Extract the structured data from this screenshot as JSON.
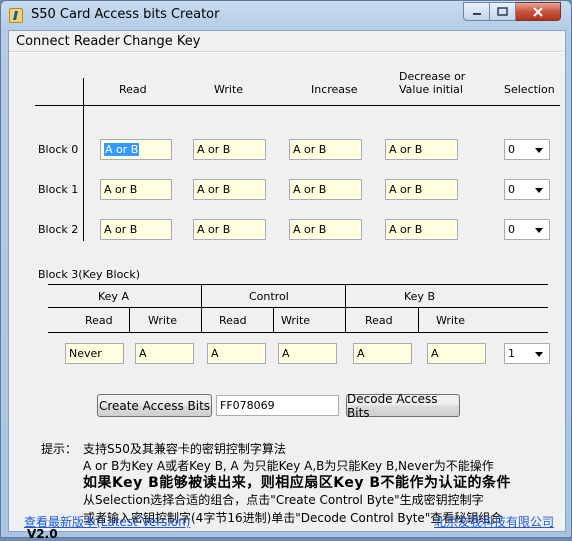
{
  "window": {
    "title": "S50 Card Access bits Creator"
  },
  "menu": {
    "connect_reader": "Connect Reader",
    "change_key": "Change Key"
  },
  "table1": {
    "headers": {
      "read": "Read",
      "write": "Write",
      "increase": "Increase",
      "decrease_line1": "Decrease or",
      "decrease_line2": "Value initial",
      "selection": "Selection"
    },
    "rows": [
      {
        "label": "Block 0",
        "read": "A or B",
        "write": "A or B",
        "increase": "A or B",
        "decrease": "A or B",
        "selection": "0"
      },
      {
        "label": "Block 1",
        "read": "A or B",
        "write": "A or B",
        "increase": "A or B",
        "decrease": "A or B",
        "selection": "0"
      },
      {
        "label": "Block 2",
        "read": "A or B",
        "write": "A or B",
        "increase": "A or B",
        "decrease": "A or B",
        "selection": "0"
      }
    ]
  },
  "block3": {
    "title": "Block 3(Key Block)",
    "group_key_a": "Key A",
    "group_control": "Control",
    "group_key_b": "Key B",
    "sub_read": "Read",
    "sub_write": "Write",
    "values": {
      "key_a_read": "Never",
      "key_a_write": "A",
      "control_read": "A",
      "control_write": "A",
      "key_b_read": "A",
      "key_b_write": "A",
      "selection": "1"
    }
  },
  "actions": {
    "create_label": "Create Access Bits",
    "access_bits_value": "FF078069",
    "decode_label": "Decode Access Bits"
  },
  "tips": {
    "label": "提示：",
    "line1": "支持S50及其兼容卡的密钥控制字算法",
    "line2": "A or B为Key A或者Key B, A 为只能Key A,B为只能Key B,Never为不能操作",
    "line3": "如果Key B能够被读出来，则相应扇区Key B不能作为认证的条件",
    "line4": "从Selection选择合适的组合，点击\"Create Control Byte\"生成密钥控制字",
    "line5": "或者输入密钥控制字(4字节16进制)单击\"Decode Control Byte\"查看秘钥组合"
  },
  "footer": {
    "version": "V2.0",
    "latest_version_link": "查看最新版本(Latest Version)",
    "company_link": "北京友我科技有限公司"
  },
  "colors": {
    "field_bg": "#ffffdf",
    "link": "#1e5bd6",
    "selection_highlight": "#3399ff"
  }
}
